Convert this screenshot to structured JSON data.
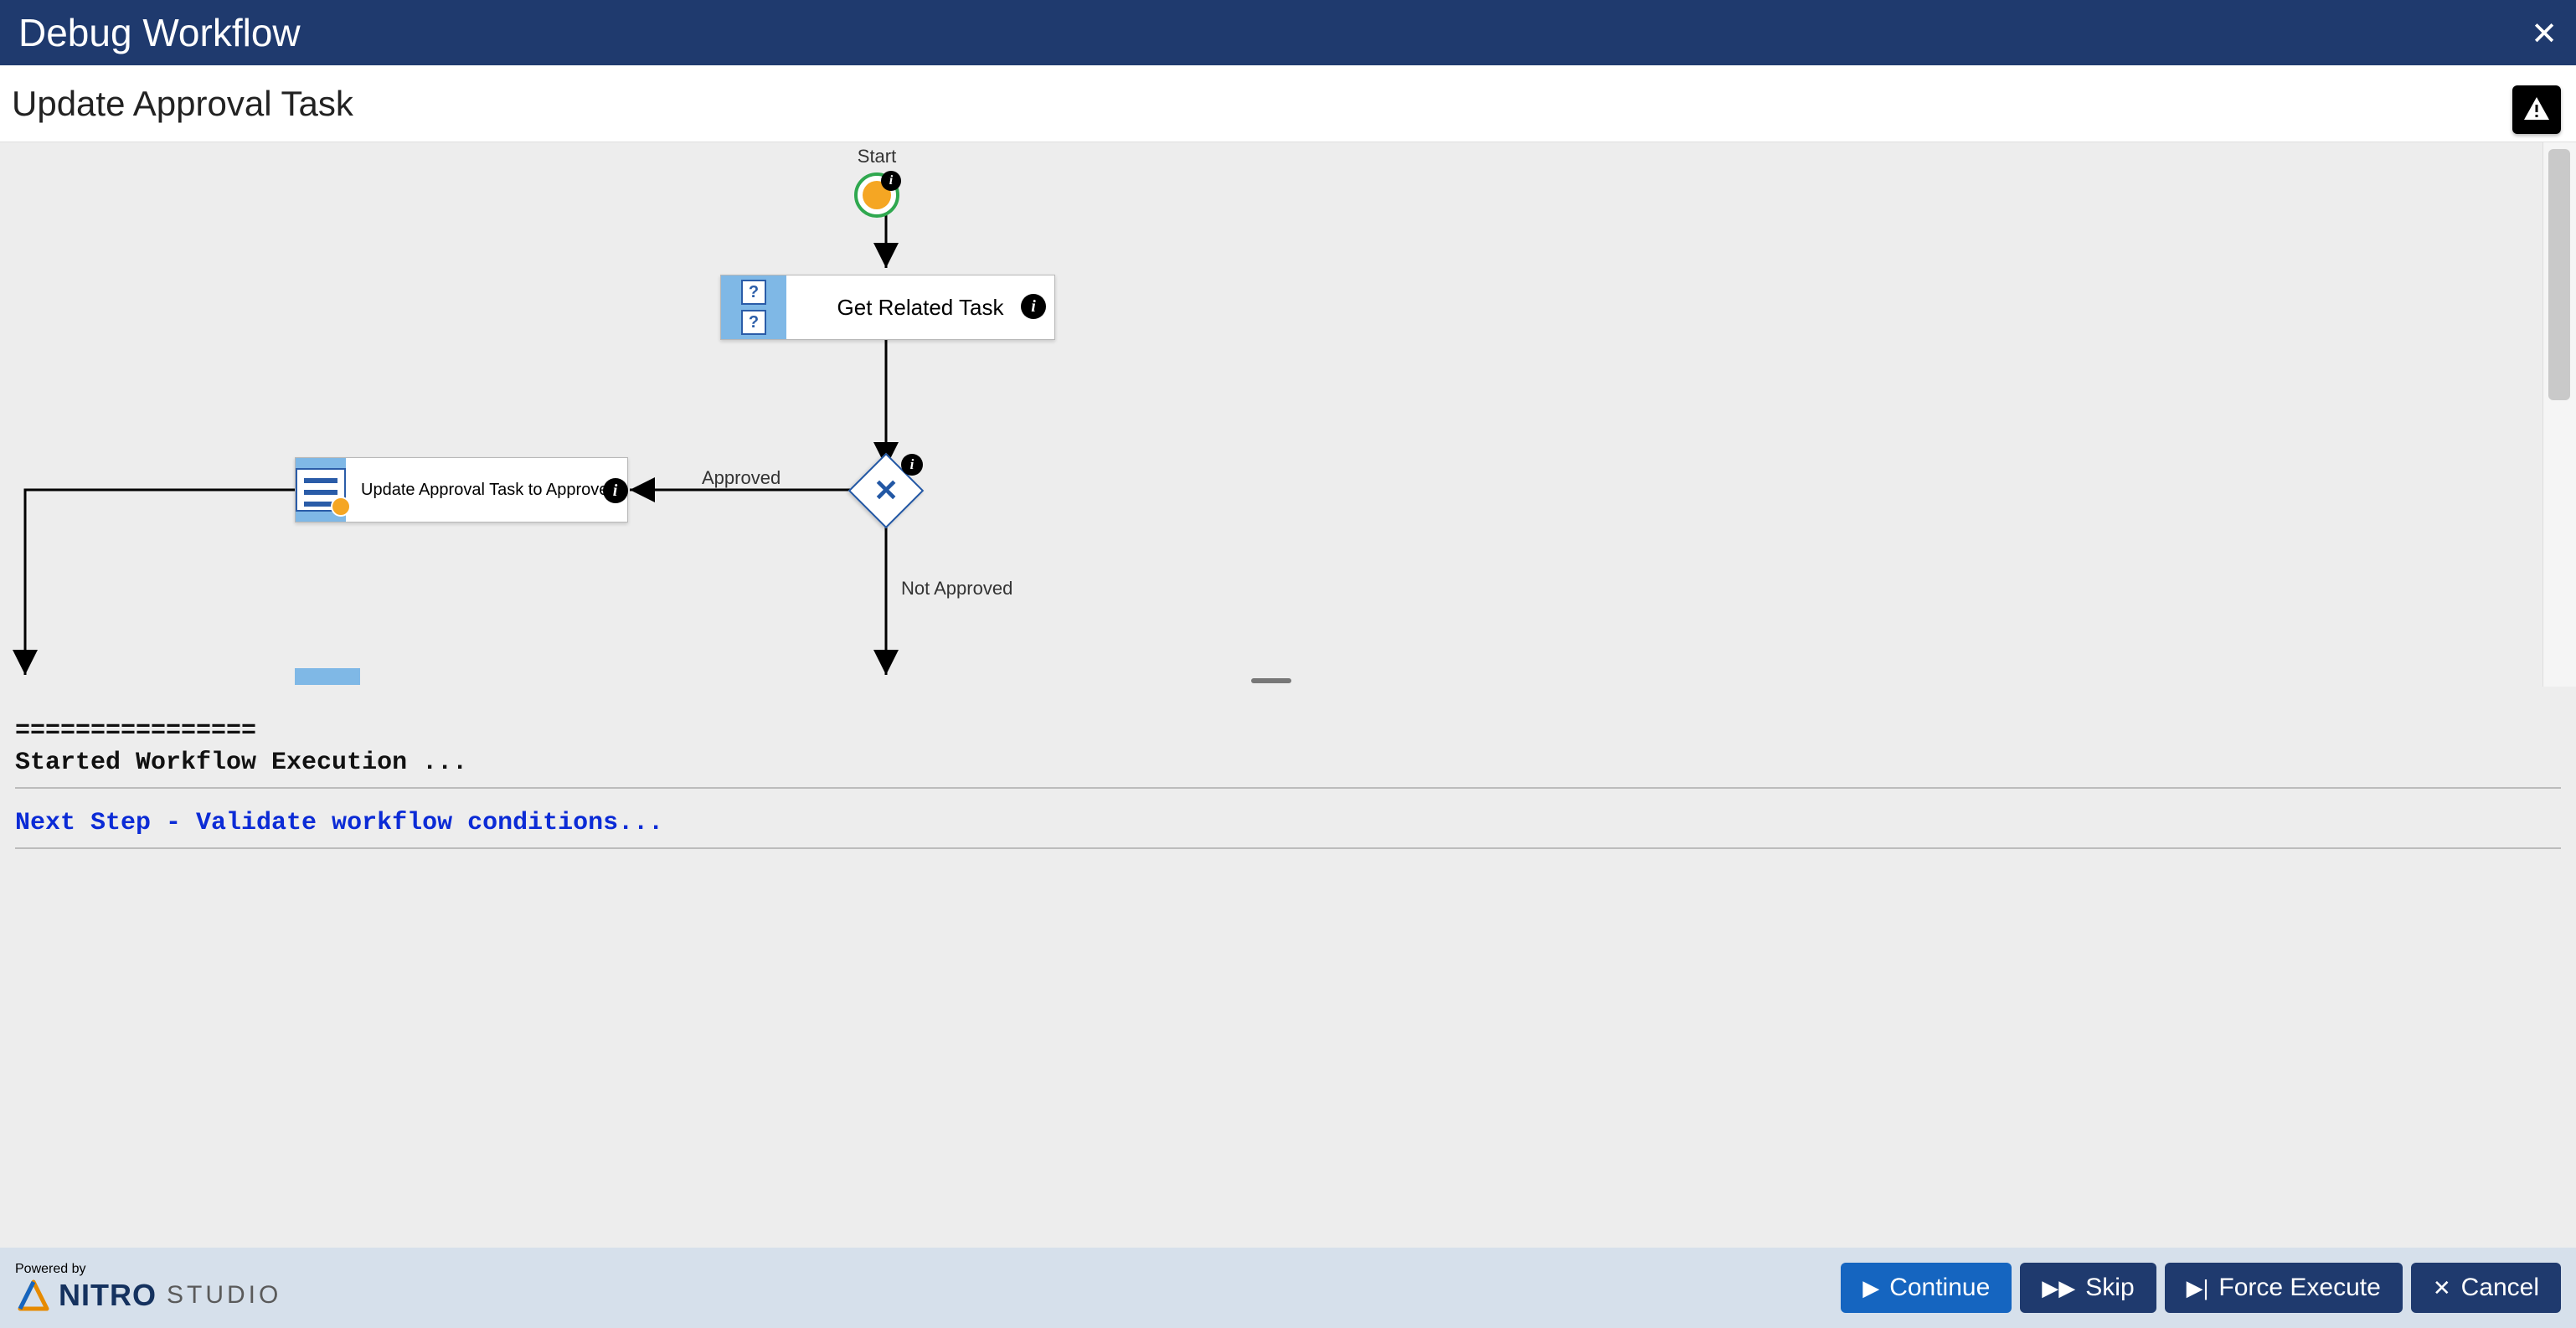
{
  "titlebar": {
    "title": "Debug Workflow"
  },
  "subheader": {
    "title": "Update Approval Task"
  },
  "diagram": {
    "start_label": "Start",
    "node_get_related": "Get Related Task",
    "node_update_approval": "Update Approval Task to Approved",
    "edge_approved": "Approved",
    "edge_not_approved": "Not Approved"
  },
  "log": {
    "divider": "================",
    "line1": "Started Workflow Execution ...",
    "next_step": "Next Step - Validate workflow conditions..."
  },
  "footer": {
    "powered_by": "Powered by",
    "brand_bold": "NITRO",
    "brand_light": "STUDIO",
    "buttons": {
      "continue": "Continue",
      "skip": "Skip",
      "force_execute": "Force Execute",
      "cancel": "Cancel"
    }
  }
}
